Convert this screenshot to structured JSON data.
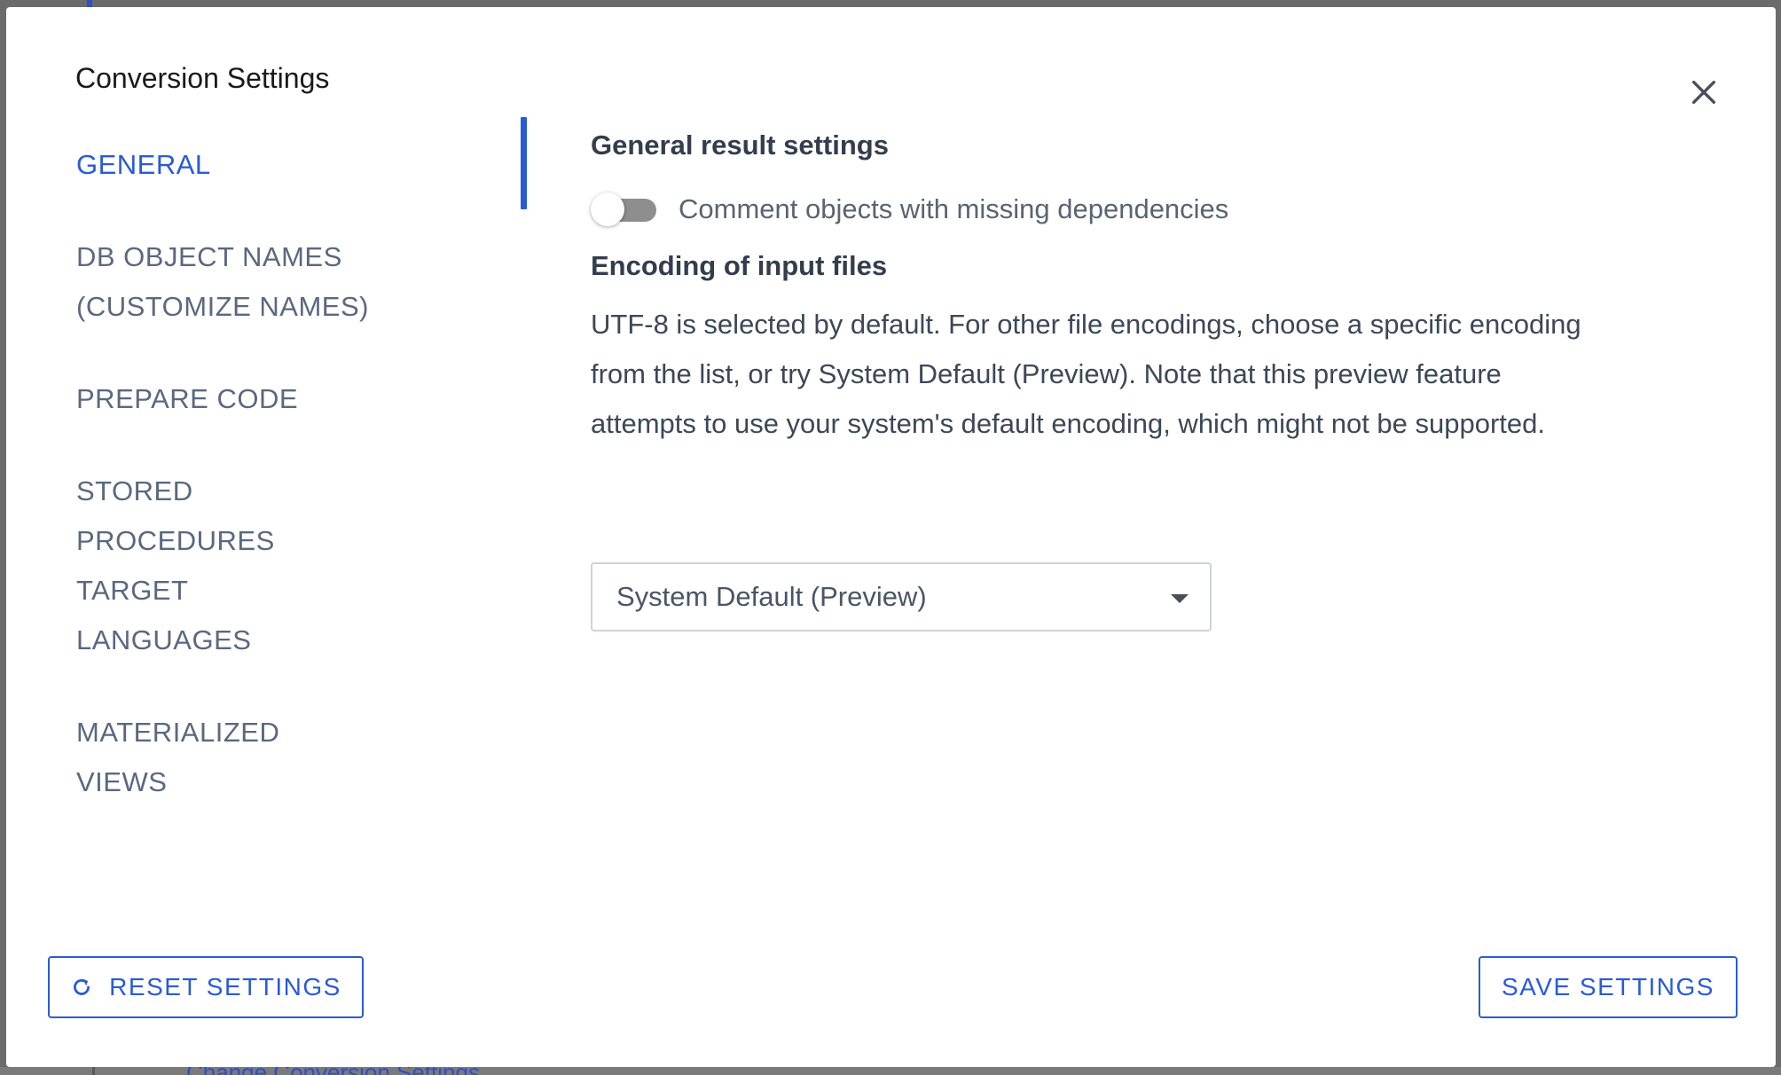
{
  "background": {
    "link_text": "Change Conversion Settings"
  },
  "modal": {
    "title": "Conversion Settings",
    "close_icon": "close-icon"
  },
  "nav": {
    "items": [
      {
        "label": "GENERAL",
        "active": true
      },
      {
        "label": "DB OBJECT NAMES (CUSTOMIZE NAMES)",
        "active": false
      },
      {
        "label": "PREPARE CODE",
        "active": false
      },
      {
        "label": "STORED PROCEDURES TARGET LANGUAGES",
        "active": false
      },
      {
        "label": "MATERIALIZED VIEWS",
        "active": false
      }
    ]
  },
  "content": {
    "section_title": "General result settings",
    "toggle": {
      "label": "Comment objects with missing dependencies",
      "checked": false
    },
    "encoding_title": "Encoding of input files",
    "encoding_description": "UTF-8 is selected by default. For other file encodings, choose a specific encoding from the list, or try System Default (Preview). Note that this preview feature attempts to use your system's default encoding, which might not be supported.",
    "encoding_select": {
      "value": "System Default (Preview)",
      "icon": "chevron-down-icon"
    }
  },
  "footer": {
    "reset_label": "RESET SETTINGS",
    "reset_icon": "refresh-icon",
    "save_label": "SAVE SETTINGS"
  },
  "colors": {
    "accent": "#2a5bd7",
    "nav_text": "#5a6880",
    "toggle_track": "#8e8e8e"
  }
}
